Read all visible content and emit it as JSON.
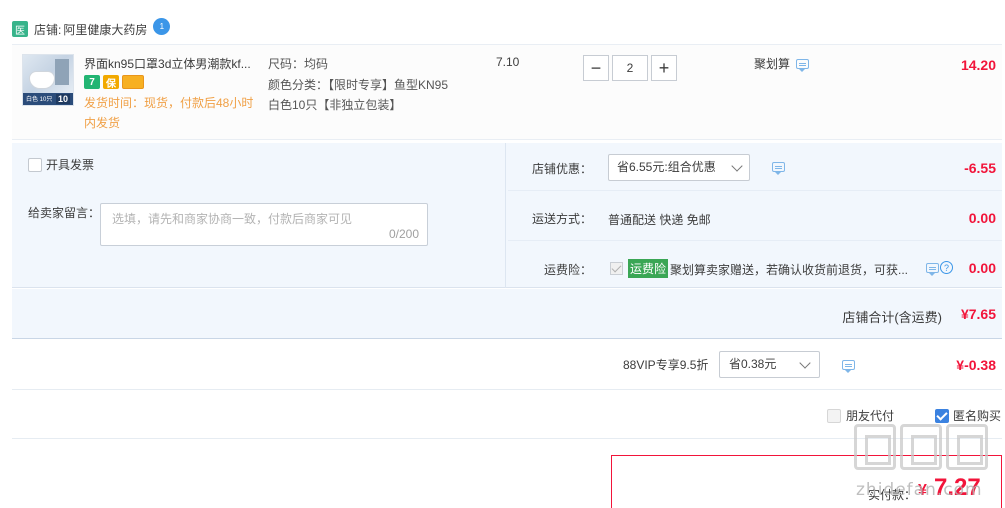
{
  "shop": {
    "badge": "医",
    "label": "店铺:",
    "name": "阿里健康大药房",
    "chat_badge": "1"
  },
  "item": {
    "title": "界面kn95口罩3d立体男潮款kf...",
    "thumb_text": "白色 10只",
    "thumb_qty": "10",
    "icon_1": "7",
    "icon_2": "保",
    "ship_time": "发货时间：现货，付款后48小时内发货",
    "sku_size": "尺码：均码",
    "sku_color": "颜色分类：【限时专享】鱼型KN95白色10只【非独立包装】",
    "unit_price": "7.10",
    "quantity": "2",
    "qty_minus": "−",
    "qty_plus": "+",
    "promo": "聚划算",
    "total": "14.20"
  },
  "options": {
    "invoice_label": "开具发票",
    "message_label": "给卖家留言：",
    "message_placeholder": "选填，请先和商家协商一致，付款后商家可见",
    "message_count": "0/200",
    "discount_label": "店铺优惠：",
    "discount_select": "省6.55元:组合优惠",
    "discount_amount": "-6.55",
    "shipping_label": "运送方式：",
    "shipping_value": "普通配送 快递 免邮",
    "shipping_amount": "0.00",
    "insurance_label": "运费险：",
    "insurance_tag": "运费险",
    "insurance_desc": "聚划算卖家赠送，若确认收货前退货，可获...",
    "insurance_help": "?",
    "insurance_amount": "0.00"
  },
  "shop_total": {
    "label": "店铺合计(含运费)",
    "value": "¥7.65"
  },
  "vip": {
    "label": "88VIP专享9.5折",
    "select": "省0.38元",
    "amount": "¥-0.38"
  },
  "anon": {
    "friend_pay": "朋友代付",
    "anonymous": "匿名购买"
  },
  "payment": {
    "label": "实付款：",
    "currency": "¥",
    "value": "7.27"
  },
  "watermark": {
    "text": "zhidefan.com"
  },
  "colors": {
    "price_red": "#f2143a",
    "panel_blue": "#f2f7fd",
    "ship_orange": "#f0a046",
    "insurance_green": "#3aa655",
    "check_blue": "#3b82e0"
  }
}
